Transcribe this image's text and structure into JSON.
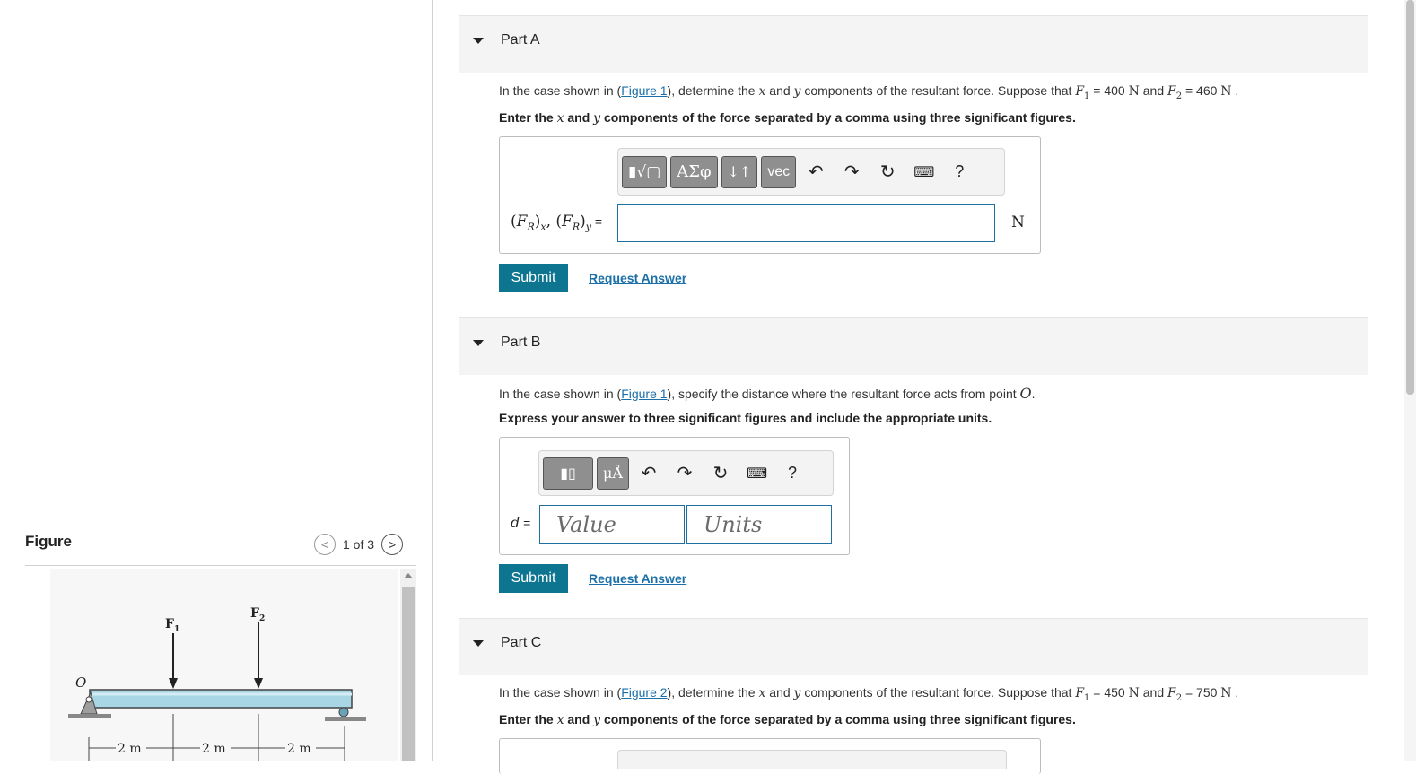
{
  "figure_panel": {
    "title": "Figure",
    "pager_text": "1 of 3",
    "prev_glyph": "<",
    "next_glyph": ">",
    "diagram": {
      "force1": "F",
      "force1_sub": "1",
      "force2": "F",
      "force2_sub": "2",
      "origin": "O",
      "dims": [
        "2 m",
        "2 m",
        "2 m"
      ]
    }
  },
  "parts": [
    {
      "label": "Part A",
      "question": {
        "pre": "In the case shown in (",
        "link": "Figure 1",
        "mid": "), determine the ",
        "v1": "x",
        "and1": " and ",
        "v2": "y",
        "post": " components of the resultant force. Suppose that ",
        "f1": "F",
        "f1_sub": "1",
        "f1_val": " = 400 ",
        "unitN1": "N",
        "and2": " and ",
        "f2": "F",
        "f2_sub": "2",
        "f2_val": " = 460 ",
        "unitN2": "N",
        "end": " ."
      },
      "instruction": {
        "pre": "Enter the ",
        "v1": "x",
        "and": " and ",
        "v2": "y",
        "post": " components of the force separated by a comma using three significant figures."
      },
      "toolbar": {
        "templates": "▮√▢",
        "greek": "ΑΣφ",
        "arrows": "↓↑",
        "vec": "vec",
        "undo": "↶",
        "redo": "↷",
        "reset": "↻",
        "keyboard": "⌨",
        "help": "?"
      },
      "input_label": "(F",
      "input_label_full": "(FR)x, (FR)y =",
      "input_value": "",
      "unit": "N",
      "submit": "Submit",
      "request": "Request Answer"
    },
    {
      "label": "Part B",
      "question": {
        "pre": "In the case shown in (",
        "link": "Figure 1",
        "post": "), specify the distance where the resultant force acts from point ",
        "point": "O",
        "end": "."
      },
      "instruction": "Express your answer to three significant figures and include the appropriate units.",
      "toolbar": {
        "templates": "▮▯",
        "units": "μÅ",
        "undo": "↶",
        "redo": "↷",
        "reset": "↻",
        "keyboard": "⌨",
        "help": "?"
      },
      "input_label": "d =",
      "value_placeholder": "Value",
      "units_placeholder": "Units",
      "submit": "Submit",
      "request": "Request Answer"
    },
    {
      "label": "Part C",
      "question": {
        "pre": "In the case shown in (",
        "link": "Figure 2",
        "mid": "), determine the ",
        "v1": "x",
        "and1": " and ",
        "v2": "y",
        "post": " components of the resultant force. Suppose that ",
        "f1": "F",
        "f1_sub": "1",
        "f1_val": " = 450 ",
        "unitN1": "N",
        "and2": " and ",
        "f2": "F",
        "f2_sub": "2",
        "f2_val": " = 750 ",
        "unitN2": "N",
        "end": " ."
      },
      "instruction": {
        "pre": "Enter the ",
        "v1": "x",
        "and": " and ",
        "v2": "y",
        "post": " components of the force separated by a comma using three significant figures."
      }
    }
  ]
}
